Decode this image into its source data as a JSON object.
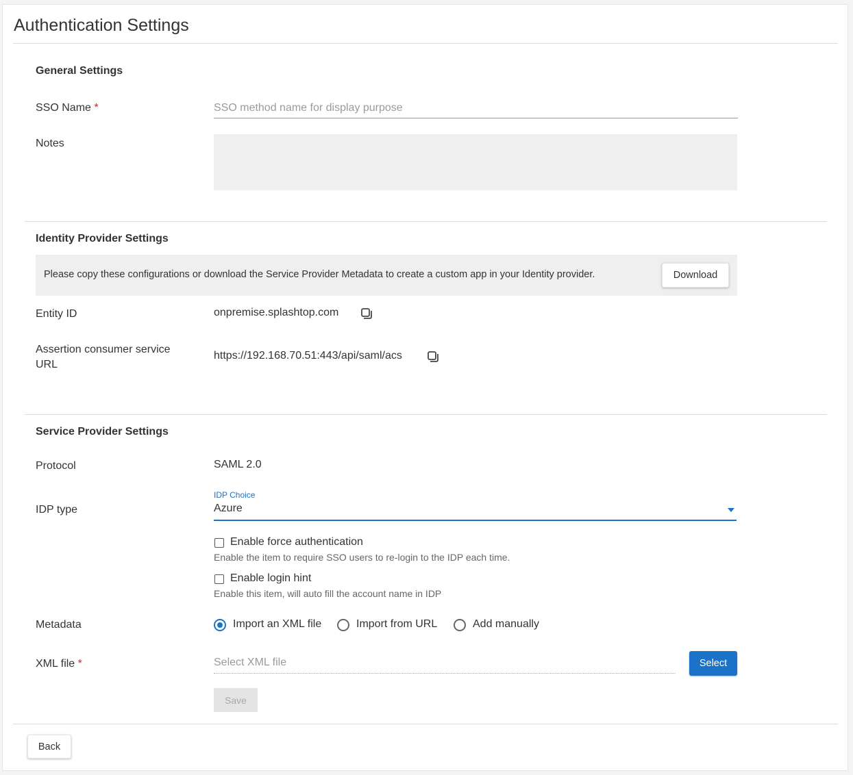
{
  "page": {
    "title": "Authentication Settings"
  },
  "general": {
    "title": "General Settings",
    "sso_name_label": "SSO Name",
    "required_mark": "*",
    "sso_name_placeholder": "SSO method name for display purpose",
    "sso_name_value": "",
    "notes_label": "Notes",
    "notes_value": ""
  },
  "idp_settings": {
    "title": "Identity Provider Settings",
    "info_text": "Please copy these configurations or download the Service Provider Metadata to create a custom app in your Identity provider.",
    "download_label": "Download",
    "entity_id_label": "Entity ID",
    "entity_id_value": "onpremise.splashtop.com",
    "acs_label_line1": "Assertion consumer service",
    "acs_label_line2": "URL",
    "acs_value": "https://192.168.70.51:443/api/saml/acs"
  },
  "sp_settings": {
    "title": "Service Provider Settings",
    "protocol_label": "Protocol",
    "protocol_value": "SAML 2.0",
    "idp_type_label": "IDP type",
    "idp_choice_label": "IDP Choice",
    "idp_choice_value": "Azure",
    "force_auth_label": "Enable force authentication",
    "force_auth_checked": false,
    "force_auth_hint": "Enable the item to require SSO users to re-login to the IDP each time.",
    "login_hint_label": "Enable login hint",
    "login_hint_checked": false,
    "login_hint_hint": "Enable this item, will auto fill the account name in IDP",
    "metadata_label": "Metadata",
    "metadata_options": [
      "Import an XML file",
      "Import from URL",
      "Add manually"
    ],
    "metadata_selected": "Import an XML file",
    "xml_file_label": "XML file",
    "xml_file_placeholder": "Select XML file",
    "select_label": "Select",
    "save_label": "Save"
  },
  "footer": {
    "back_label": "Back"
  },
  "colors": {
    "accent": "#1a73c8",
    "required": "#e02020",
    "panel_bg": "#efefef"
  }
}
